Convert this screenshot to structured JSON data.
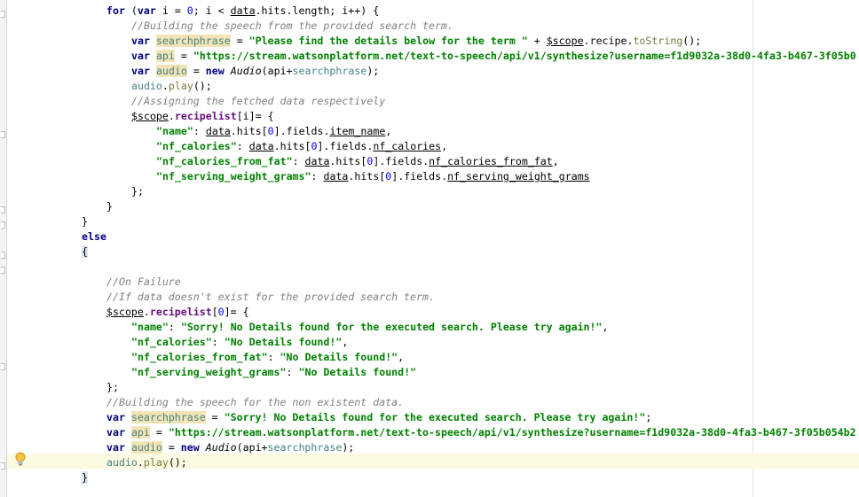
{
  "editor": {
    "lines": [
      [
        {
          "t": "for",
          "c": "kw"
        },
        {
          "t": " ("
        },
        {
          "t": "var",
          "c": "kw"
        },
        {
          "t": " i = "
        },
        {
          "t": "0",
          "c": "num"
        },
        {
          "t": "; i < "
        },
        {
          "t": "data",
          "c": "u"
        },
        {
          "t": ".hits.length; i++) {"
        }
      ],
      [
        {
          "t": "//Building the speech from the provided search term.",
          "c": "cmt"
        }
      ],
      [
        {
          "t": "var",
          "c": "kw"
        },
        {
          "t": " "
        },
        {
          "t": "searchphrase",
          "c": "dv hl"
        },
        {
          "t": " = "
        },
        {
          "t": "\"Please find the details below for the term \"",
          "c": "str"
        },
        {
          "t": " + "
        },
        {
          "t": "$scope",
          "c": "u"
        },
        {
          "t": ".recipe."
        },
        {
          "t": "toString",
          "c": "mth"
        },
        {
          "t": "();"
        }
      ],
      [
        {
          "t": "var",
          "c": "kw"
        },
        {
          "t": " "
        },
        {
          "t": "api",
          "c": "dv hl"
        },
        {
          "t": " = "
        },
        {
          "t": "\"https://stream.watsonplatform.net/text-to-speech/api/v1/synthesize?username=f1d9032a-38d0-4fa3-b467-3f05b0",
          "c": "str"
        }
      ],
      [
        {
          "t": "var",
          "c": "kw"
        },
        {
          "t": " "
        },
        {
          "t": "audio",
          "c": "dv hl"
        },
        {
          "t": " = "
        },
        {
          "t": "new",
          "c": "kw"
        },
        {
          "t": " "
        },
        {
          "t": "Audio",
          "c": "ctor"
        },
        {
          "t": "(api+"
        },
        {
          "t": "searchphrase",
          "c": "dv"
        },
        {
          "t": ");"
        }
      ],
      [
        {
          "t": "audio",
          "c": "dv"
        },
        {
          "t": "."
        },
        {
          "t": "play",
          "c": "mth"
        },
        {
          "t": "();"
        }
      ],
      [
        {
          "t": "//Assigning the fetched data respectively",
          "c": "cmt"
        }
      ],
      [
        {
          "t": "$scope",
          "c": "u"
        },
        {
          "t": "."
        },
        {
          "t": "recipelist",
          "c": "gv"
        },
        {
          "t": "[i]= {"
        }
      ],
      [
        {
          "t": "\"name\"",
          "c": "str"
        },
        {
          "t": ": "
        },
        {
          "t": "data",
          "c": "u"
        },
        {
          "t": ".hits["
        },
        {
          "t": "0",
          "c": "num"
        },
        {
          "t": "].fields."
        },
        {
          "t": "item_name",
          "c": "u"
        },
        {
          "t": ","
        }
      ],
      [
        {
          "t": "\"nf_calories\"",
          "c": "str"
        },
        {
          "t": ": "
        },
        {
          "t": "data",
          "c": "u"
        },
        {
          "t": ".hits["
        },
        {
          "t": "0",
          "c": "num"
        },
        {
          "t": "].fields."
        },
        {
          "t": "nf_calories",
          "c": "u"
        },
        {
          "t": ","
        }
      ],
      [
        {
          "t": "\"nf_calories_from_fat\"",
          "c": "str"
        },
        {
          "t": ": "
        },
        {
          "t": "data",
          "c": "u"
        },
        {
          "t": ".hits["
        },
        {
          "t": "0",
          "c": "num"
        },
        {
          "t": "].fields."
        },
        {
          "t": "nf_calories_from_fat",
          "c": "u"
        },
        {
          "t": ","
        }
      ],
      [
        {
          "t": "\"nf_serving_weight_grams\"",
          "c": "str"
        },
        {
          "t": ": "
        },
        {
          "t": "data",
          "c": "u"
        },
        {
          "t": ".hits["
        },
        {
          "t": "0",
          "c": "num"
        },
        {
          "t": "].fields."
        },
        {
          "t": "nf_serving_weight_grams",
          "c": "u"
        }
      ],
      [
        {
          "t": "};"
        }
      ],
      [
        {
          "t": "}"
        }
      ],
      [
        {
          "t": "}"
        }
      ],
      [
        {
          "t": "else",
          "c": "kw"
        }
      ],
      [
        {
          "t": "{",
          "c": "brk"
        }
      ],
      [],
      [
        {
          "t": "//On Failure",
          "c": "cmt"
        }
      ],
      [
        {
          "t": "//If data doesn't exist for the provided search term.",
          "c": "cmt"
        }
      ],
      [
        {
          "t": "$scope",
          "c": "u"
        },
        {
          "t": "."
        },
        {
          "t": "recipelist",
          "c": "gv"
        },
        {
          "t": "["
        },
        {
          "t": "0",
          "c": "num"
        },
        {
          "t": "]= {"
        }
      ],
      [
        {
          "t": "\"name\"",
          "c": "str"
        },
        {
          "t": ": "
        },
        {
          "t": "\"Sorry! No Details found for the executed search. Please try again!\"",
          "c": "str"
        },
        {
          "t": ","
        }
      ],
      [
        {
          "t": "\"nf_calories\"",
          "c": "str"
        },
        {
          "t": ": "
        },
        {
          "t": "\"No Details found!\"",
          "c": "str"
        },
        {
          "t": ","
        }
      ],
      [
        {
          "t": "\"nf_calories_from_fat\"",
          "c": "str"
        },
        {
          "t": ": "
        },
        {
          "t": "\"No Details found!\"",
          "c": "str"
        },
        {
          "t": ","
        }
      ],
      [
        {
          "t": "\"nf_serving_weight_grams\"",
          "c": "str"
        },
        {
          "t": ": "
        },
        {
          "t": "\"No Details found!\"",
          "c": "str"
        }
      ],
      [
        {
          "t": "};"
        }
      ],
      [
        {
          "t": "//Building the speech for the non existent data.",
          "c": "cmt"
        }
      ],
      [
        {
          "t": "var",
          "c": "kw"
        },
        {
          "t": " "
        },
        {
          "t": "searchphrase",
          "c": "dv hl"
        },
        {
          "t": " = "
        },
        {
          "t": "\"Sorry! No Details found for the executed search. Please try again!\"",
          "c": "str"
        },
        {
          "t": ";"
        }
      ],
      [
        {
          "t": "var",
          "c": "kw"
        },
        {
          "t": " "
        },
        {
          "t": "api",
          "c": "dv hl"
        },
        {
          "t": " = "
        },
        {
          "t": "\"https://stream.watsonplatform.net/text-to-speech/api/v1/synthesize?username=f1d9032a-38d0-4fa3-b467-3f05b054b2",
          "c": "str"
        }
      ],
      [
        {
          "t": "var",
          "c": "kw"
        },
        {
          "t": " "
        },
        {
          "t": "audio",
          "c": "dv hl"
        },
        {
          "t": " = "
        },
        {
          "t": "new",
          "c": "kw"
        },
        {
          "t": " "
        },
        {
          "t": "Audio",
          "c": "ctor"
        },
        {
          "t": "(api+"
        },
        {
          "t": "searchphrase",
          "c": "dv"
        },
        {
          "t": ");"
        }
      ],
      [
        {
          "t": "audio",
          "c": "dv"
        },
        {
          "t": "."
        },
        {
          "t": "play",
          "c": "mth"
        },
        {
          "t": "();"
        }
      ],
      [
        {
          "t": "}",
          "c": "brk"
        }
      ],
      [],
      [
        {
          "t": "} }"
        }
      ]
    ]
  }
}
